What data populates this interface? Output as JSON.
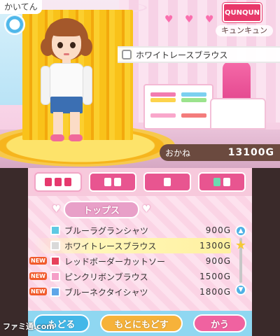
{
  "top_screen": {
    "store_label": "かいてん",
    "brand": {
      "logo_text": "QUNQUN",
      "name": "キュンキュン"
    },
    "selected_item_name": "ホワイトレースブラウス",
    "money": {
      "label": "おかね",
      "value": "13100G"
    }
  },
  "category_tabs": [
    {
      "icon": "tops-icon",
      "selected": true
    },
    {
      "icon": "bottoms-icon",
      "selected": false
    },
    {
      "icon": "socks-icon",
      "selected": false
    },
    {
      "icon": "shoes-icon",
      "selected": false
    }
  ],
  "section": {
    "title": "トップス"
  },
  "items": [
    {
      "name": "ブルーラグランシャツ",
      "price": "900G",
      "new": false,
      "icon_color": "#5fc9e3",
      "selected": false
    },
    {
      "name": "ホワイトレースブラウス",
      "price": "1300G",
      "new": false,
      "icon_color": "#d9d9d9",
      "selected": true
    },
    {
      "name": "レッドボーダーカットソー",
      "price": "900G",
      "new": true,
      "icon_color": "#e7425c",
      "selected": false
    },
    {
      "name": "ピンクリボンブラウス",
      "price": "1500G",
      "new": true,
      "icon_color": "#f59fc8",
      "selected": false
    },
    {
      "name": "ブルーネクタイシャツ",
      "price": "1800G",
      "new": true,
      "icon_color": "#5fa6e8",
      "selected": false
    }
  ],
  "new_badge": "NEW",
  "actions": {
    "back": "もどる",
    "reset": "もとにもどす",
    "buy": "かう"
  },
  "watermark": "ファミ通.com"
}
